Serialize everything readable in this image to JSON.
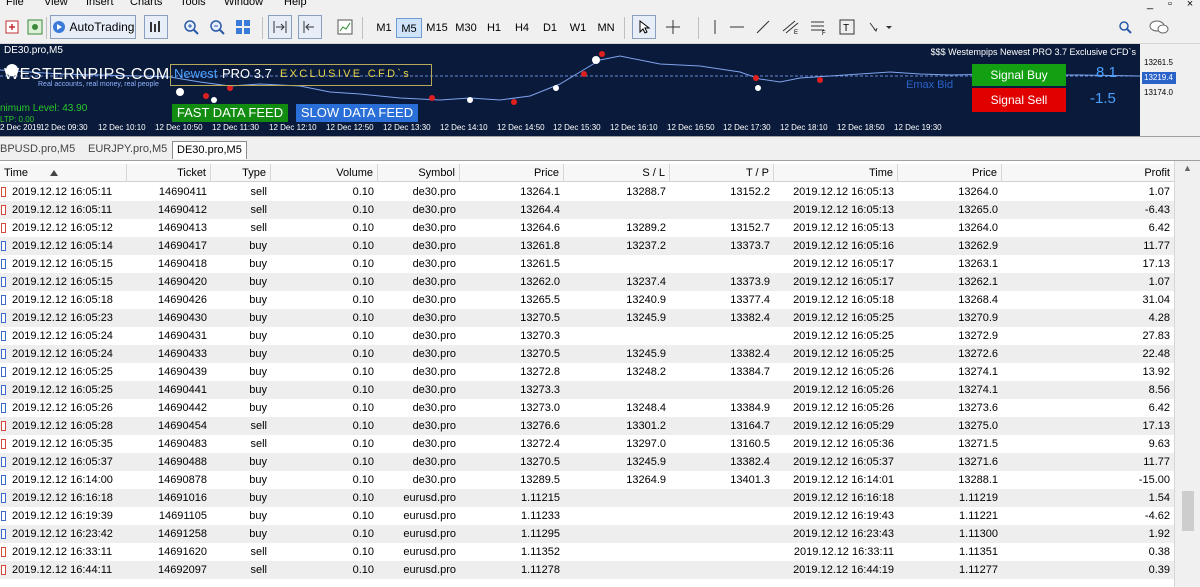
{
  "menu": [
    "File",
    "View",
    "Insert",
    "Charts",
    "Tools",
    "Window",
    "Help"
  ],
  "toolbar": {
    "autotrading_label": "AutoTrading",
    "timeframes": [
      "M1",
      "M5",
      "M15",
      "M30",
      "H1",
      "H4",
      "D1",
      "W1",
      "MN"
    ],
    "active_timeframe": "M5"
  },
  "chart": {
    "window_title": "DE30.pro,M5",
    "indicator_title": "$$$ Westempips Newest PRO 3.7 Exclusive CFD`s",
    "logo_text": "WESTERNPIPS.COM",
    "logo_sub": "Real accounts, real money, real people",
    "banner_newest": "Newest",
    "banner_pro": "PRO 3.7",
    "banner_exclusive": "EXCLUSIVE CFD`s",
    "min_level": "nimum Level: 43.90",
    "ltp": "LTP: 0.00",
    "fast_feed": "FAST DATA FEED",
    "slow_feed": "SLOW DATA FEED",
    "emax_bid": "Emax Bid",
    "signal_buy_label": "Signal Buy",
    "signal_sell_label": "Signal Sell",
    "signal_buy_value": "8.1",
    "signal_sell_value": "-1.5",
    "price_high": "13261.5",
    "price_current": "13219.4",
    "price_low": "13174.0",
    "time_ticks": [
      "2 Dec 2019",
      "12 Dec 09:30",
      "12 Dec 10:10",
      "12 Dec 10:50",
      "12 Dec 11:30",
      "12 Dec 12:10",
      "12 Dec 12:50",
      "12 Dec 13:30",
      "12 Dec 14:10",
      "12 Dec 14:50",
      "12 Dec 15:30",
      "12 Dec 16:10",
      "12 Dec 16:50",
      "12 Dec 17:30",
      "12 Dec 18:10",
      "12 Dec 18:50",
      "12 Dec 19:30"
    ]
  },
  "chart_tabs": [
    "BPUSD.pro,M5",
    "EURJPY.pro,M5",
    "DE30.pro,M5"
  ],
  "active_chart_tab": "DE30.pro,M5",
  "table": {
    "columns": [
      "Time",
      "Ticket",
      "Type",
      "Volume",
      "Symbol",
      "Price",
      "S / L",
      "T / P",
      "Time",
      "Price",
      "Profit"
    ],
    "rows": [
      [
        "2019.12.12 16:05:11",
        "14690411",
        "sell",
        "0.10",
        "de30.pro",
        "13264.1",
        "13288.7",
        "13152.2",
        "2019.12.12 16:05:13",
        "13264.0",
        "1.07"
      ],
      [
        "2019.12.12 16:05:11",
        "14690412",
        "sell",
        "0.10",
        "de30.pro",
        "13264.4",
        "",
        "",
        "2019.12.12 16:05:13",
        "13265.0",
        "-6.43"
      ],
      [
        "2019.12.12 16:05:12",
        "14690413",
        "sell",
        "0.10",
        "de30.pro",
        "13264.6",
        "13289.2",
        "13152.7",
        "2019.12.12 16:05:13",
        "13264.0",
        "6.42"
      ],
      [
        "2019.12.12 16:05:14",
        "14690417",
        "buy",
        "0.10",
        "de30.pro",
        "13261.8",
        "13237.2",
        "13373.7",
        "2019.12.12 16:05:16",
        "13262.9",
        "11.77"
      ],
      [
        "2019.12.12 16:05:15",
        "14690418",
        "buy",
        "0.10",
        "de30.pro",
        "13261.5",
        "",
        "",
        "2019.12.12 16:05:17",
        "13263.1",
        "17.13"
      ],
      [
        "2019.12.12 16:05:15",
        "14690420",
        "buy",
        "0.10",
        "de30.pro",
        "13262.0",
        "13237.4",
        "13373.9",
        "2019.12.12 16:05:17",
        "13262.1",
        "1.07"
      ],
      [
        "2019.12.12 16:05:18",
        "14690426",
        "buy",
        "0.10",
        "de30.pro",
        "13265.5",
        "13240.9",
        "13377.4",
        "2019.12.12 16:05:18",
        "13268.4",
        "31.04"
      ],
      [
        "2019.12.12 16:05:23",
        "14690430",
        "buy",
        "0.10",
        "de30.pro",
        "13270.5",
        "13245.9",
        "13382.4",
        "2019.12.12 16:05:25",
        "13270.9",
        "4.28"
      ],
      [
        "2019.12.12 16:05:24",
        "14690431",
        "buy",
        "0.10",
        "de30.pro",
        "13270.3",
        "",
        "",
        "2019.12.12 16:05:25",
        "13272.9",
        "27.83"
      ],
      [
        "2019.12.12 16:05:24",
        "14690433",
        "buy",
        "0.10",
        "de30.pro",
        "13270.5",
        "13245.9",
        "13382.4",
        "2019.12.12 16:05:25",
        "13272.6",
        "22.48"
      ],
      [
        "2019.12.12 16:05:25",
        "14690439",
        "buy",
        "0.10",
        "de30.pro",
        "13272.8",
        "13248.2",
        "13384.7",
        "2019.12.12 16:05:26",
        "13274.1",
        "13.92"
      ],
      [
        "2019.12.12 16:05:25",
        "14690441",
        "buy",
        "0.10",
        "de30.pro",
        "13273.3",
        "",
        "",
        "2019.12.12 16:05:26",
        "13274.1",
        "8.56"
      ],
      [
        "2019.12.12 16:05:26",
        "14690442",
        "buy",
        "0.10",
        "de30.pro",
        "13273.0",
        "13248.4",
        "13384.9",
        "2019.12.12 16:05:26",
        "13273.6",
        "6.42"
      ],
      [
        "2019.12.12 16:05:28",
        "14690454",
        "sell",
        "0.10",
        "de30.pro",
        "13276.6",
        "13301.2",
        "13164.7",
        "2019.12.12 16:05:29",
        "13275.0",
        "17.13"
      ],
      [
        "2019.12.12 16:05:35",
        "14690483",
        "sell",
        "0.10",
        "de30.pro",
        "13272.4",
        "13297.0",
        "13160.5",
        "2019.12.12 16:05:36",
        "13271.5",
        "9.63"
      ],
      [
        "2019.12.12 16:05:37",
        "14690488",
        "buy",
        "0.10",
        "de30.pro",
        "13270.5",
        "13245.9",
        "13382.4",
        "2019.12.12 16:05:37",
        "13271.6",
        "11.77"
      ],
      [
        "2019.12.12 16:14:00",
        "14690878",
        "buy",
        "0.10",
        "de30.pro",
        "13289.5",
        "13264.9",
        "13401.3",
        "2019.12.12 16:14:01",
        "13288.1",
        "-15.00"
      ],
      [
        "2019.12.12 16:16:18",
        "14691016",
        "buy",
        "0.10",
        "eurusd.pro",
        "1.11215",
        "",
        "",
        "2019.12.12 16:16:18",
        "1.11219",
        "1.54"
      ],
      [
        "2019.12.12 16:19:39",
        "14691105",
        "buy",
        "0.10",
        "eurusd.pro",
        "1.11233",
        "",
        "",
        "2019.12.12 16:19:43",
        "1.11221",
        "-4.62"
      ],
      [
        "2019.12.12 16:23:42",
        "14691258",
        "buy",
        "0.10",
        "eurusd.pro",
        "1.11295",
        "",
        "",
        "2019.12.12 16:23:43",
        "1.11300",
        "1.92"
      ],
      [
        "2019.12.12 16:33:11",
        "14691620",
        "sell",
        "0.10",
        "eurusd.pro",
        "1.11352",
        "",
        "",
        "2019.12.12 16:33:11",
        "1.11351",
        "0.38"
      ],
      [
        "2019.12.12 16:44:11",
        "14692097",
        "sell",
        "0.10",
        "eurusd.pro",
        "1.11278",
        "",
        "",
        "2019.12.12 16:44:19",
        "1.11277",
        "0.39"
      ]
    ]
  }
}
